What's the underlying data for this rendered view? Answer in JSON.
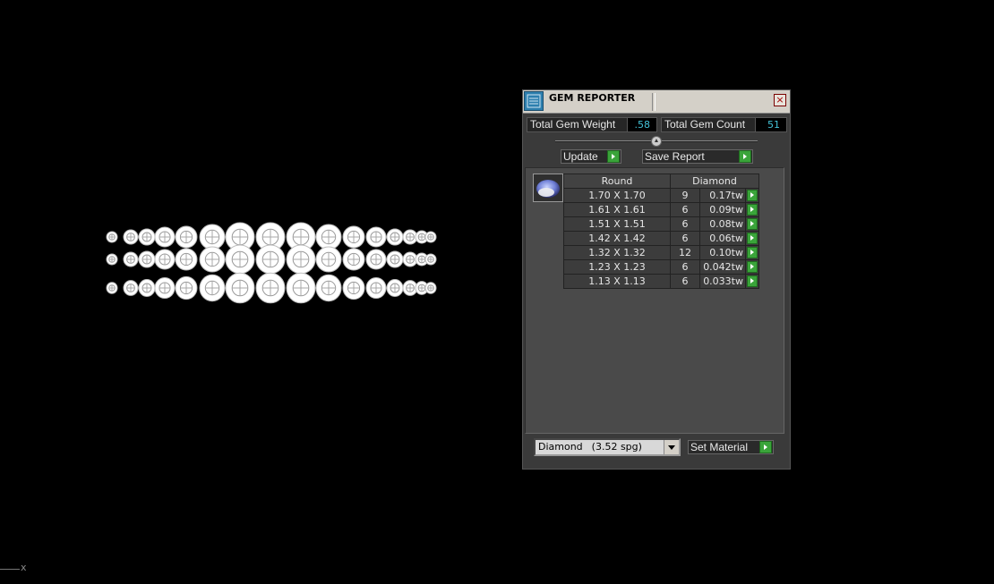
{
  "panel": {
    "title": "GEM REPORTER",
    "close_glyph": "×",
    "icon": "gem-reporter-icon",
    "total_weight_label": "Total Gem Weight",
    "total_weight_value": ".58",
    "total_count_label": "Total Gem Count",
    "total_count_value": "51",
    "update_label": "Update",
    "save_report_label": "Save Report",
    "table": {
      "shape_header": "Round",
      "material_header": "Diamond",
      "rows": [
        {
          "size": "1.70 X 1.70",
          "count": "9",
          "weight": "0.17tw"
        },
        {
          "size": "1.61 X 1.61",
          "count": "6",
          "weight": "0.09tw"
        },
        {
          "size": "1.51 X 1.51",
          "count": "6",
          "weight": "0.08tw"
        },
        {
          "size": "1.42 X 1.42",
          "count": "6",
          "weight": "0.06tw"
        },
        {
          "size": "1.32 X 1.32",
          "count": "12",
          "weight": "0.10tw"
        },
        {
          "size": "1.23 X 1.23",
          "count": "6",
          "weight": "0.042tw"
        },
        {
          "size": "1.13 X 1.13",
          "count": "6",
          "weight": "0.033tw"
        }
      ]
    },
    "material_select": {
      "name": "Diamond",
      "spg": "(3.52 spg)"
    },
    "set_material_label": "Set Material"
  },
  "viewport": {
    "axis_label": "x"
  },
  "colors": {
    "accent_green": "#3aa43a",
    "value_cyan": "#43c3d8",
    "panel_bg": "#3a3a3a"
  }
}
